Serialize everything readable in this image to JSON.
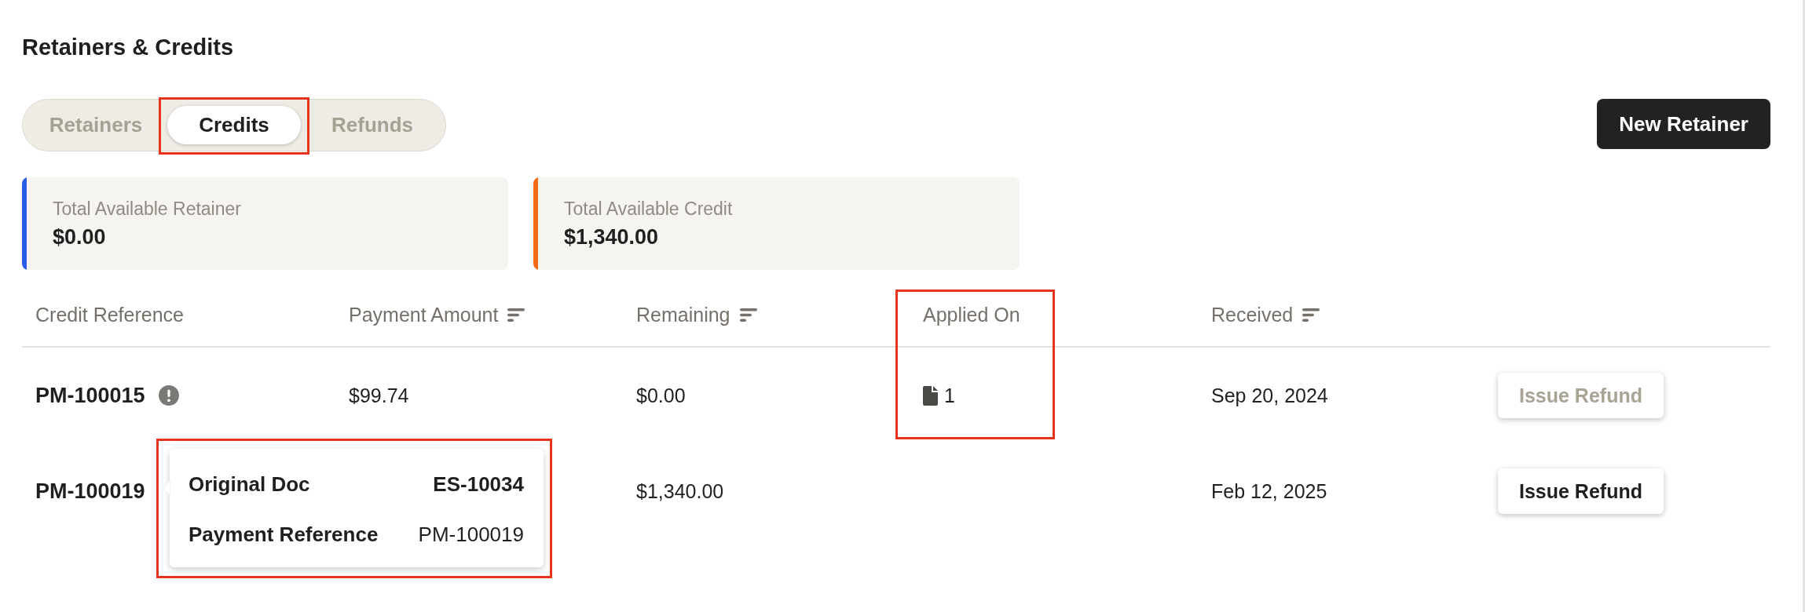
{
  "page": {
    "title": "Retainers & Credits"
  },
  "tabs": [
    {
      "label": "Retainers",
      "selected": false,
      "highlighted": false
    },
    {
      "label": "Credits",
      "selected": true,
      "highlighted": true
    },
    {
      "label": "Refunds",
      "selected": false,
      "highlighted": false
    }
  ],
  "primary_button": {
    "label": "New Retainer"
  },
  "summary_cards": [
    {
      "label": "Total Available Retainer",
      "value": "$0.00",
      "color": "#2a5ce8"
    },
    {
      "label": "Total Available Credit",
      "value": "$1,340.00",
      "color": "#f76b15"
    }
  ],
  "table": {
    "columns": [
      {
        "label": "Credit Reference",
        "sortable": false,
        "highlighted": false
      },
      {
        "label": "Payment Amount",
        "sortable": true,
        "highlighted": false
      },
      {
        "label": "Remaining",
        "sortable": true,
        "highlighted": false
      },
      {
        "label": "Applied On",
        "sortable": false,
        "highlighted": true
      },
      {
        "label": "Received",
        "sortable": true,
        "highlighted": false
      }
    ],
    "rows": [
      {
        "credit_reference": "PM-100015",
        "warning": true,
        "payment_amount": "$99.74",
        "remaining": "$0.00",
        "applied_on": "1",
        "received": "Sep 20, 2024",
        "action": {
          "label": "Issue Refund",
          "disabled": true
        }
      },
      {
        "credit_reference": "PM-100019",
        "warning": false,
        "remaining": "$1,340.00",
        "received": "Feb 12, 2025",
        "action": {
          "label": "Issue Refund",
          "disabled": false
        },
        "tooltip": {
          "highlighted": true,
          "items": [
            {
              "label": "Original Doc",
              "value": "ES-10034",
              "bold": true
            },
            {
              "label": "Payment Reference",
              "value": "PM-100019",
              "bold": false
            }
          ]
        }
      }
    ]
  }
}
